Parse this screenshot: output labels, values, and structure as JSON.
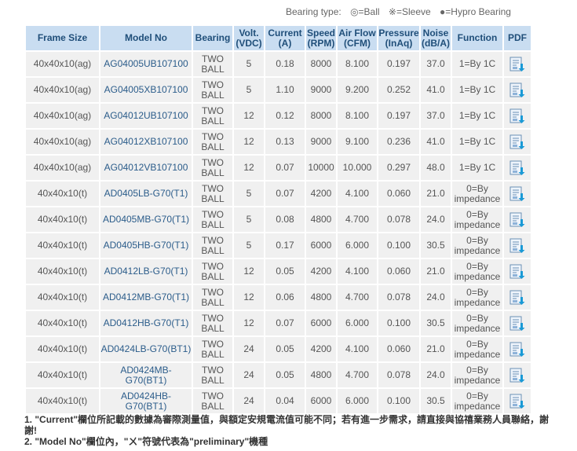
{
  "legend": {
    "label": "Bearing type:",
    "ball": "◎=Ball",
    "sleeve": "※=Sleeve",
    "hypro": "●=Hypro Bearing"
  },
  "headers": {
    "frame_size": "Frame Size",
    "model_no": "Model No",
    "bearing": "Bearing",
    "volt_1": "Volt.",
    "volt_2": "(VDC)",
    "current_1": "Current",
    "current_2": "(A)",
    "speed_1": "Speed",
    "speed_2": "(RPM)",
    "airflow_1": "Air Flow",
    "airflow_2": "(CFM)",
    "pressure_1": "Pressure",
    "pressure_2": "(InAq)",
    "noise_1": "Noise",
    "noise_2": "(dB/A)",
    "function": "Function",
    "pdf": "PDF"
  },
  "rows": [
    {
      "frame": "40x40x10(ag)",
      "model": "AG04005UB107100",
      "bearing_1": "TWO",
      "bearing_2": "BALL",
      "volt": "5",
      "current": "0.18",
      "speed": "8000",
      "airflow": "8.100",
      "pressure": "0.197",
      "noise": "37.0",
      "function_1": "1=By 1C",
      "function_2": ""
    },
    {
      "frame": "40x40x10(ag)",
      "model": "AG04005XB107100",
      "bearing_1": "TWO",
      "bearing_2": "BALL",
      "volt": "5",
      "current": "1.10",
      "speed": "9000",
      "airflow": "9.200",
      "pressure": "0.252",
      "noise": "41.0",
      "function_1": "1=By 1C",
      "function_2": ""
    },
    {
      "frame": "40x40x10(ag)",
      "model": "AG04012UB107100",
      "bearing_1": "TWO",
      "bearing_2": "BALL",
      "volt": "12",
      "current": "0.12",
      "speed": "8000",
      "airflow": "8.100",
      "pressure": "0.197",
      "noise": "37.0",
      "function_1": "1=By 1C",
      "function_2": ""
    },
    {
      "frame": "40x40x10(ag)",
      "model": "AG04012XB107100",
      "bearing_1": "TWO",
      "bearing_2": "BALL",
      "volt": "12",
      "current": "0.13",
      "speed": "9000",
      "airflow": "9.100",
      "pressure": "0.236",
      "noise": "41.0",
      "function_1": "1=By 1C",
      "function_2": ""
    },
    {
      "frame": "40x40x10(ag)",
      "model": "AG04012VB107100",
      "bearing_1": "TWO",
      "bearing_2": "BALL",
      "volt": "12",
      "current": "0.07",
      "speed": "10000",
      "airflow": "10.000",
      "pressure": "0.297",
      "noise": "48.0",
      "function_1": "1=By 1C",
      "function_2": ""
    },
    {
      "frame": "40x40x10(t)",
      "model": "AD0405LB-G70(T1)",
      "bearing_1": "TWO",
      "bearing_2": "BALL",
      "volt": "5",
      "current": "0.07",
      "speed": "4200",
      "airflow": "4.100",
      "pressure": "0.060",
      "noise": "21.0",
      "function_1": "0=By",
      "function_2": "impedance"
    },
    {
      "frame": "40x40x10(t)",
      "model": "AD0405MB-G70(T1)",
      "bearing_1": "TWO",
      "bearing_2": "BALL",
      "volt": "5",
      "current": "0.08",
      "speed": "4800",
      "airflow": "4.700",
      "pressure": "0.078",
      "noise": "24.0",
      "function_1": "0=By",
      "function_2": "impedance"
    },
    {
      "frame": "40x40x10(t)",
      "model": "AD0405HB-G70(T1)",
      "bearing_1": "TWO",
      "bearing_2": "BALL",
      "volt": "5",
      "current": "0.17",
      "speed": "6000",
      "airflow": "6.000",
      "pressure": "0.100",
      "noise": "30.5",
      "function_1": "0=By",
      "function_2": "impedance"
    },
    {
      "frame": "40x40x10(t)",
      "model": "AD0412LB-G70(T1)",
      "bearing_1": "TWO",
      "bearing_2": "BALL",
      "volt": "12",
      "current": "0.05",
      "speed": "4200",
      "airflow": "4.100",
      "pressure": "0.060",
      "noise": "21.0",
      "function_1": "0=By",
      "function_2": "impedance"
    },
    {
      "frame": "40x40x10(t)",
      "model": "AD0412MB-G70(T1)",
      "bearing_1": "TWO",
      "bearing_2": "BALL",
      "volt": "12",
      "current": "0.06",
      "speed": "4800",
      "airflow": "4.700",
      "pressure": "0.078",
      "noise": "24.0",
      "function_1": "0=By",
      "function_2": "impedance"
    },
    {
      "frame": "40x40x10(t)",
      "model": "AD0412HB-G70(T1)",
      "bearing_1": "TWO",
      "bearing_2": "BALL",
      "volt": "12",
      "current": "0.07",
      "speed": "6000",
      "airflow": "6.000",
      "pressure": "0.100",
      "noise": "30.5",
      "function_1": "0=By",
      "function_2": "impedance"
    },
    {
      "frame": "40x40x10(t)",
      "model": "AD0424LB-G70(BT1)",
      "bearing_1": "TWO",
      "bearing_2": "BALL",
      "volt": "24",
      "current": "0.05",
      "speed": "4200",
      "airflow": "4.100",
      "pressure": "0.060",
      "noise": "21.0",
      "function_1": "0=By",
      "function_2": "impedance"
    },
    {
      "frame": "40x40x10(t)",
      "model": "AD0424MB-G70(BT1)",
      "bearing_1": "TWO",
      "bearing_2": "BALL",
      "volt": "24",
      "current": "0.05",
      "speed": "4800",
      "airflow": "4.700",
      "pressure": "0.078",
      "noise": "24.0",
      "function_1": "0=By",
      "function_2": "impedance"
    },
    {
      "frame": "40x40x10(t)",
      "model": "AD0424HB-G70(BT1)",
      "bearing_1": "TWO",
      "bearing_2": "BALL",
      "volt": "24",
      "current": "0.04",
      "speed": "6000",
      "airflow": "6.000",
      "pressure": "0.100",
      "noise": "30.5",
      "function_1": "0=By",
      "function_2": "impedance"
    }
  ],
  "pdf_icon": "pdf-download-icon",
  "notes": {
    "note1": "1. \"Current\"欄位所記載的數據為審際測量值，與額定安規電流值可能不同；若有進一步需求，請直接與協禧業務人員聯絡，謝謝!",
    "note2": "2. \"Model No\"欄位內，\"ㄨ\"符號代表為\"preliminary\"機種"
  },
  "colors": {
    "header_bg": "#c9ddf1",
    "header_text": "#1f4e79",
    "cell_bg": "#f0f0f0",
    "model_text": "#2b5c8a"
  }
}
